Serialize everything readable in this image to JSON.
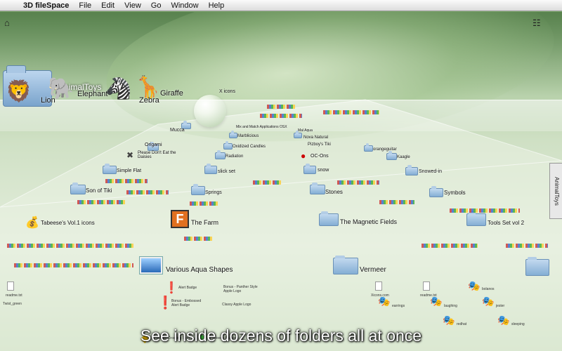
{
  "menubar": {
    "apple_icon": "",
    "app_name": "3D fileSpace",
    "items": [
      "File",
      "Edit",
      "View",
      "Go",
      "Window",
      "Help"
    ]
  },
  "shelf": {
    "title": "AnimalToys",
    "toys": [
      {
        "label": "Lion",
        "icon": "🦁"
      },
      {
        "label": "Elephant",
        "icon": "🐘"
      },
      {
        "label": "Zebra",
        "icon": "🦓"
      },
      {
        "label": "Giraffe",
        "icon": "🦒"
      }
    ],
    "x_icons_label": "X icons"
  },
  "side_tab": "AnimalToys",
  "folders": [
    {
      "label": "Mucca"
    },
    {
      "label": "Origami"
    },
    {
      "label": "Please Don't Eat the Daisies"
    },
    {
      "label": "Simple Flat"
    },
    {
      "label": "Son of Tiki"
    },
    {
      "label": "Tabeese's Vol.1 icons"
    },
    {
      "label": "The Farm"
    },
    {
      "label": "Various Aqua Shapes"
    },
    {
      "label": "Springs"
    },
    {
      "label": "slick set"
    },
    {
      "label": "Radiation"
    },
    {
      "label": "Oxidized Candles"
    },
    {
      "label": "Marblicious"
    },
    {
      "label": "Mix and Match Applications OSX"
    },
    {
      "label": "Nova Natural"
    },
    {
      "label": "Pizboy's Tiki"
    },
    {
      "label": "OC-Ons"
    },
    {
      "label": "snow"
    },
    {
      "label": "Stones"
    },
    {
      "label": "The Magnetic Fields"
    },
    {
      "label": "Vermeer"
    },
    {
      "label": "Symbols"
    },
    {
      "label": "Tools Set vol 2"
    },
    {
      "label": "Snowed-in"
    },
    {
      "label": "orangeguitar"
    },
    {
      "label": "Kaagle"
    },
    {
      "label": "Mal Aqua"
    }
  ],
  "front_items": {
    "alert_badge": "Alert Badge",
    "bonus_alert": "Bonus - Embossed Alert Badge",
    "bonus_panther": "Bonus - Panther Style Apple Logo",
    "classy_apple": "Classy Apple Logo",
    "school_sign": "School Crossing Sign",
    "speech_bubble": "Speech Bubble",
    "readme": "readme.txt",
    "twist": "Twist_green",
    "xicons": "Xicons.com",
    "readme2": "readme.txt",
    "bolanos": "bolanos",
    "earrings": "earrings",
    "laughing": "laughing",
    "jester": "jester",
    "redhat": "redhat",
    "sleeping": "sleeping"
  },
  "caption": "See inside dozens of folders all at once"
}
